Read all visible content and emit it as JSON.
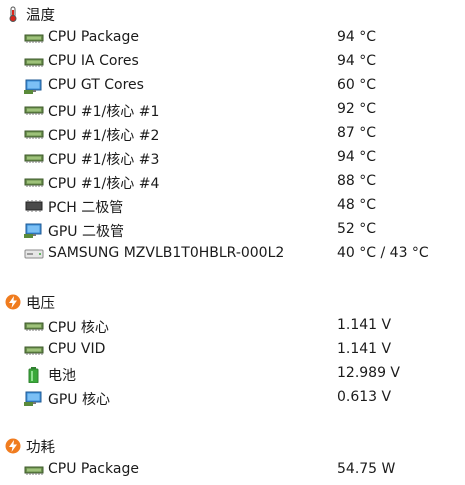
{
  "sections": {
    "temperature": {
      "title": "温度",
      "icon": "thermometer-icon",
      "items": [
        {
          "label": "CPU Package",
          "value": "94 °C",
          "icon": "cpu-chip-icon"
        },
        {
          "label": "CPU IA Cores",
          "value": "94 °C",
          "icon": "cpu-chip-icon"
        },
        {
          "label": "CPU GT Cores",
          "value": "60 °C",
          "icon": "gpu-monitor-icon"
        },
        {
          "label": "CPU #1/核心 #1",
          "value": "92 °C",
          "icon": "cpu-chip-icon"
        },
        {
          "label": "CPU #1/核心 #2",
          "value": "87 °C",
          "icon": "cpu-chip-icon"
        },
        {
          "label": "CPU #1/核心 #3",
          "value": "94 °C",
          "icon": "cpu-chip-icon"
        },
        {
          "label": "CPU #1/核心 #4",
          "value": "88 °C",
          "icon": "cpu-chip-icon"
        },
        {
          "label": "PCH 二极管",
          "value": "48 °C",
          "icon": "pch-chip-icon"
        },
        {
          "label": "GPU 二极管",
          "value": "52 °C",
          "icon": "gpu-monitor-icon"
        },
        {
          "label": "SAMSUNG MZVLB1T0HBLR-000L2",
          "value": "40 °C / 43 °C",
          "icon": "drive-icon"
        }
      ]
    },
    "voltage": {
      "title": "电压",
      "icon": "lightning-bolt-icon",
      "items": [
        {
          "label": "CPU 核心",
          "value": "1.141 V",
          "icon": "cpu-chip-icon"
        },
        {
          "label": "CPU VID",
          "value": "1.141 V",
          "icon": "cpu-chip-icon"
        },
        {
          "label": "电池",
          "value": "12.989 V",
          "icon": "battery-icon"
        },
        {
          "label": "GPU 核心",
          "value": "0.613 V",
          "icon": "gpu-monitor-icon"
        }
      ]
    },
    "power": {
      "title": "功耗",
      "icon": "lightning-bolt-icon",
      "items": [
        {
          "label": "CPU Package",
          "value": "54.75 W",
          "icon": "cpu-chip-icon"
        }
      ]
    }
  },
  "colors": {
    "thermometer_red": "#d9261c",
    "bolt_orange": "#f07c1f",
    "chip_green": "#5a8a3a",
    "monitor_blue": "#3c8fd8",
    "battery_green": "#3aa83a"
  }
}
